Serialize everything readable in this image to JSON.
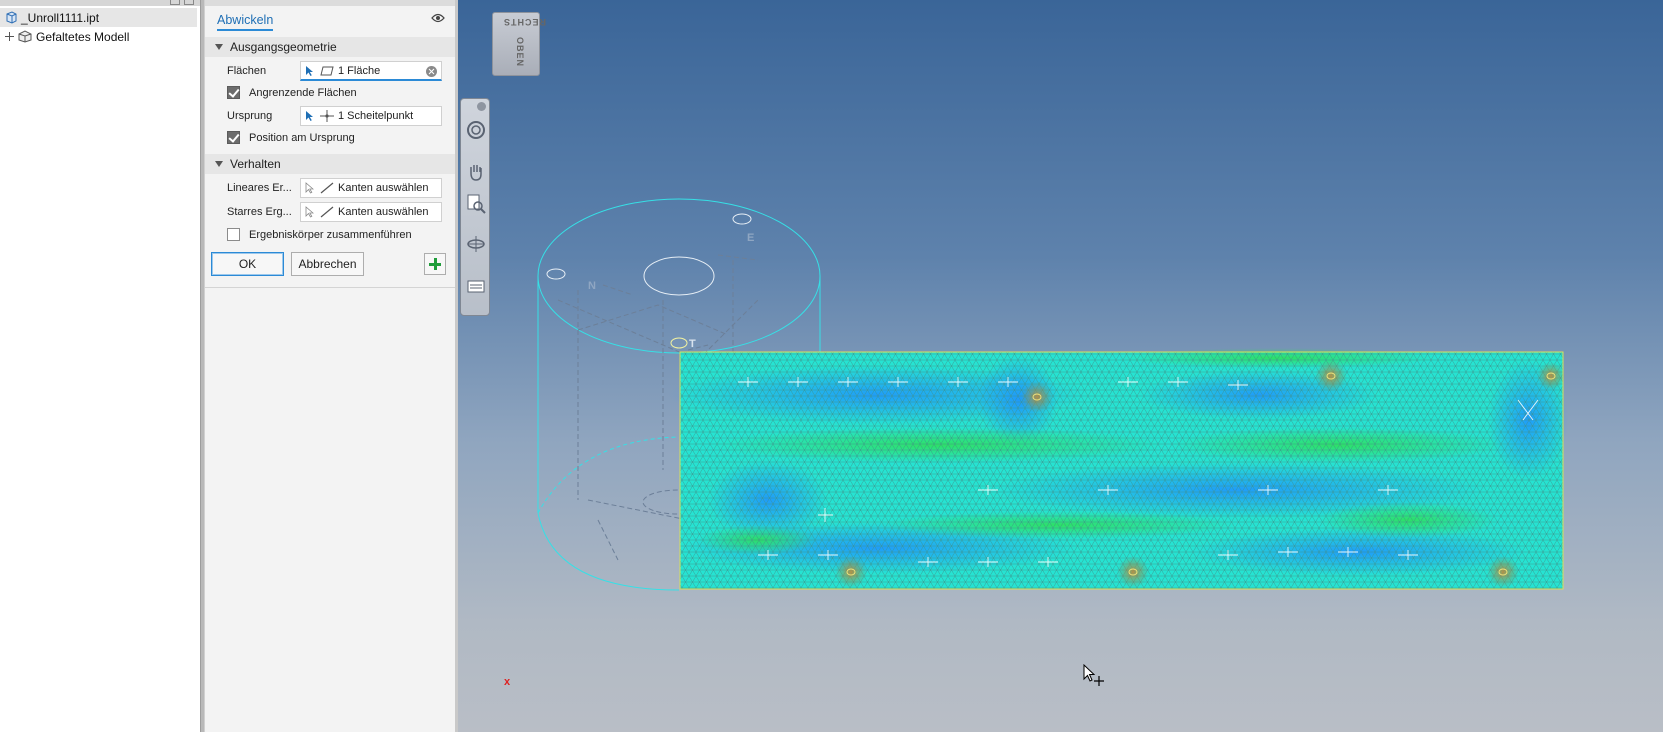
{
  "browser": {
    "items": [
      {
        "label": "_Unroll1111.ipt",
        "selected": true
      },
      {
        "label": "Gefaltetes Modell",
        "selected": false
      }
    ]
  },
  "panel": {
    "tab": "Abwickeln",
    "sections": {
      "input": "Ausgangsgeometrie",
      "behavior": "Verhalten"
    },
    "faces_label": "Flächen",
    "faces_value": "1 Fläche",
    "adjacent_faces": {
      "label": "Angrenzende Flächen",
      "checked": true
    },
    "origin_label": "Ursprung",
    "origin_value": "1 Scheitelpunkt",
    "position_at_origin": {
      "label": "Position am Ursprung",
      "checked": true
    },
    "linear_label": "Lineares Er...",
    "linear_value": "Kanten auswählen",
    "rigid_label": "Starres Erg...",
    "rigid_value": "Kanten auswählen",
    "merge_bodies": {
      "label": "Ergebniskörper zusammenführen",
      "checked": false
    },
    "ok_label": "OK",
    "cancel_label": "Abbrechen"
  },
  "viewport": {
    "viewcube_top": "OBEN",
    "viewcube_right": "RECHTS",
    "axis_label": "x",
    "model_labels": [
      "E",
      "N",
      "T"
    ]
  }
}
